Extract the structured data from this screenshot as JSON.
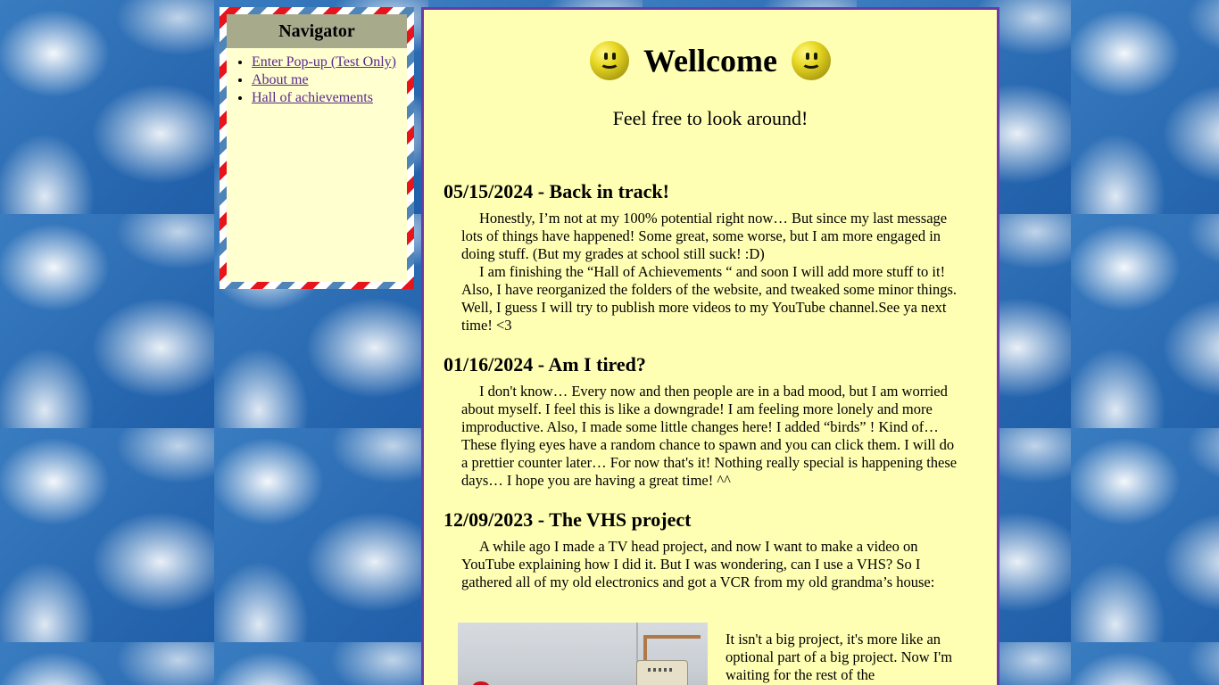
{
  "navigator": {
    "title": "Navigator",
    "links": [
      "Enter Pop-up (Test Only)",
      "About me",
      "Hall of achievements"
    ]
  },
  "header": {
    "title": "Wellcome",
    "subtitle": "Feel free to look around!"
  },
  "posts": [
    {
      "title": "05/15/2024 - Back in track!",
      "paragraphs": [
        "Honestly, I’m not at my 100% potential right now… But since my last message lots of things have happened! Some great, some worse, but I am more engaged in doing stuff. (But my grades at school still suck! :D)",
        "I am finishing the “Hall of Achievements “ and soon I will add more stuff to it! Also, I have reorganized the folders of the website, and tweaked some minor things. Well, I guess I will try to publish more videos to my YouTube channel.See ya next time! <3"
      ]
    },
    {
      "title": "01/16/2024 - Am I tired?",
      "paragraphs": [
        "I don't know… Every now and then people are in a bad mood, but I am worried about myself. I feel this is like a downgrade! I am feeling more lonely and more improductive. Also, I made some little changes here! I added “birds” ! Kind of… These flying eyes have a random chance to spawn and you can click them. I will do a prettier counter later… For now that's it! Nothing really special is happening these days… I hope you are having a great time! ^^"
      ]
    },
    {
      "title": "12/09/2023 - The VHS project",
      "paragraphs": [
        "A while ago I made a TV head project, and now I want to make a video on YouTube explaining how I did it. But I was wondering, can I use a VHS? So I gathered all of my old electronics and got a VCR from my old grandma’s house:"
      ]
    }
  ],
  "photo_caption_text": "It isn't a big project, it's more like an optional part of a big project. Now I'm waiting for the rest of the"
}
